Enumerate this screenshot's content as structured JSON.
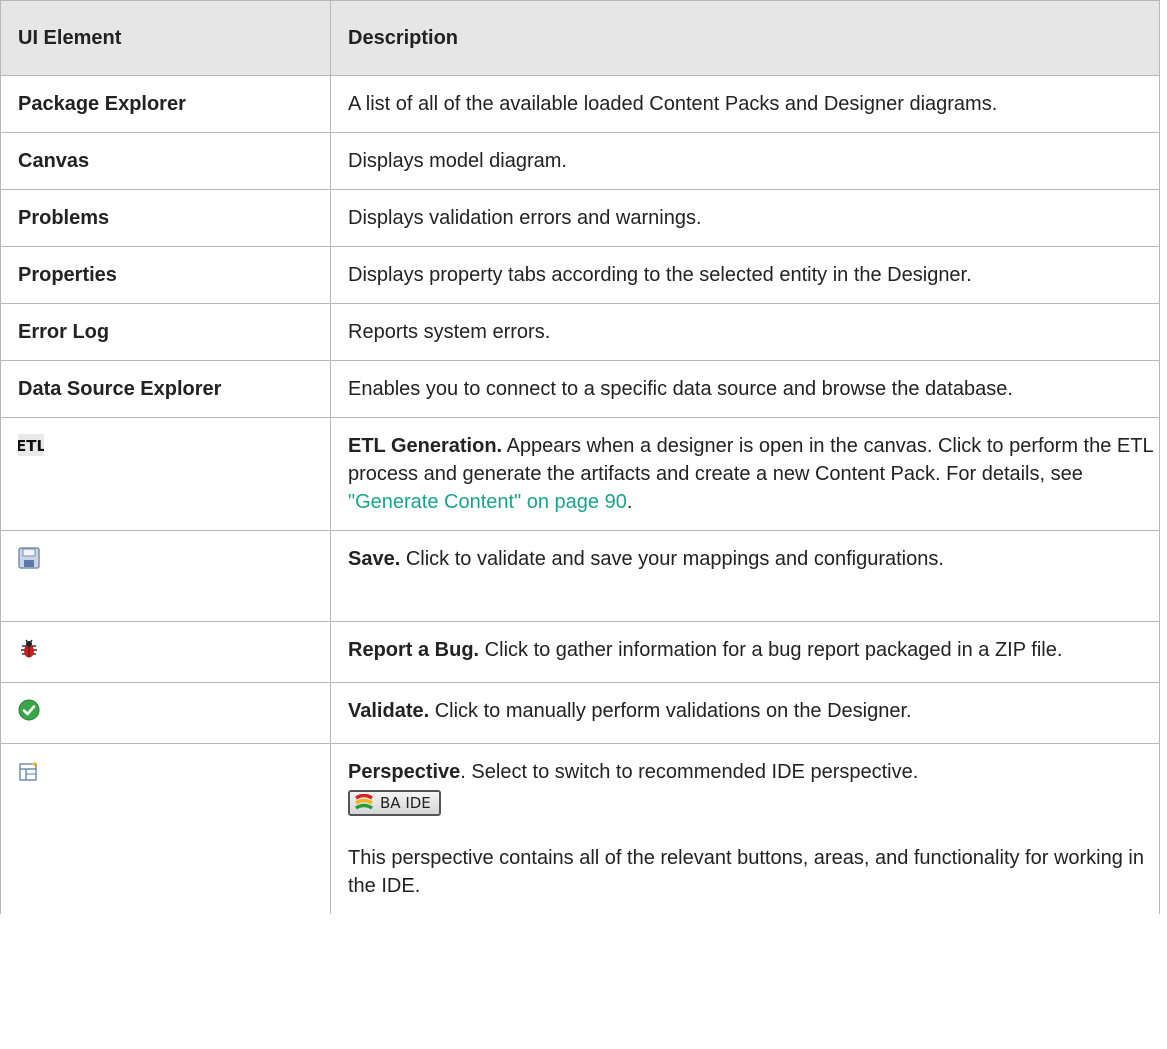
{
  "table": {
    "headers": [
      "UI Element",
      "Description"
    ],
    "rows": [
      {
        "element": "Package Explorer",
        "description": "A list of all of the available loaded Content Packs and Designer diagrams."
      },
      {
        "element": "Canvas",
        "description": "Displays model diagram."
      },
      {
        "element": "Problems",
        "description": "Displays validation errors and warnings."
      },
      {
        "element": "Properties",
        "description": "Displays property tabs according to the selected entity in the Designer."
      },
      {
        "element": "Error Log",
        "description": "Reports system errors."
      },
      {
        "element": "Data Source Explorer",
        "description": "Enables you to connect to a specific data source and browse the database."
      }
    ],
    "icon_rows": [
      {
        "icon": "etl-icon",
        "icon_text": "ETL",
        "title": "ETL Generation.",
        "description": " Appears when a designer is open in the canvas. Click to perform the ETL process and generate the artifacts and create a new Content Pack. For details, see ",
        "link": "\"Generate Content\" on page 90",
        "suffix": "."
      },
      {
        "icon": "save-icon",
        "title": "Save.",
        "description": " Click to validate and save your mappings and configurations."
      },
      {
        "icon": "bug-icon",
        "title": "Report a Bug.",
        "description": " Click to gather information for a bug report packaged in a ZIP file."
      },
      {
        "icon": "validate-check-icon",
        "title": "Validate.",
        "description": " Click to manually perform validations on the Designer."
      },
      {
        "icon": "perspective-icon",
        "title": "Perspective",
        "description": ". Select to switch to recommended IDE perspective.",
        "button_label": "BA IDE",
        "extra": "This perspective contains all of the relevant buttons, areas, and functionality for working in the IDE."
      }
    ]
  },
  "colors": {
    "header_bg": "#e6e6e6",
    "link": "#1aa38c",
    "border": "#b8b8b8"
  }
}
